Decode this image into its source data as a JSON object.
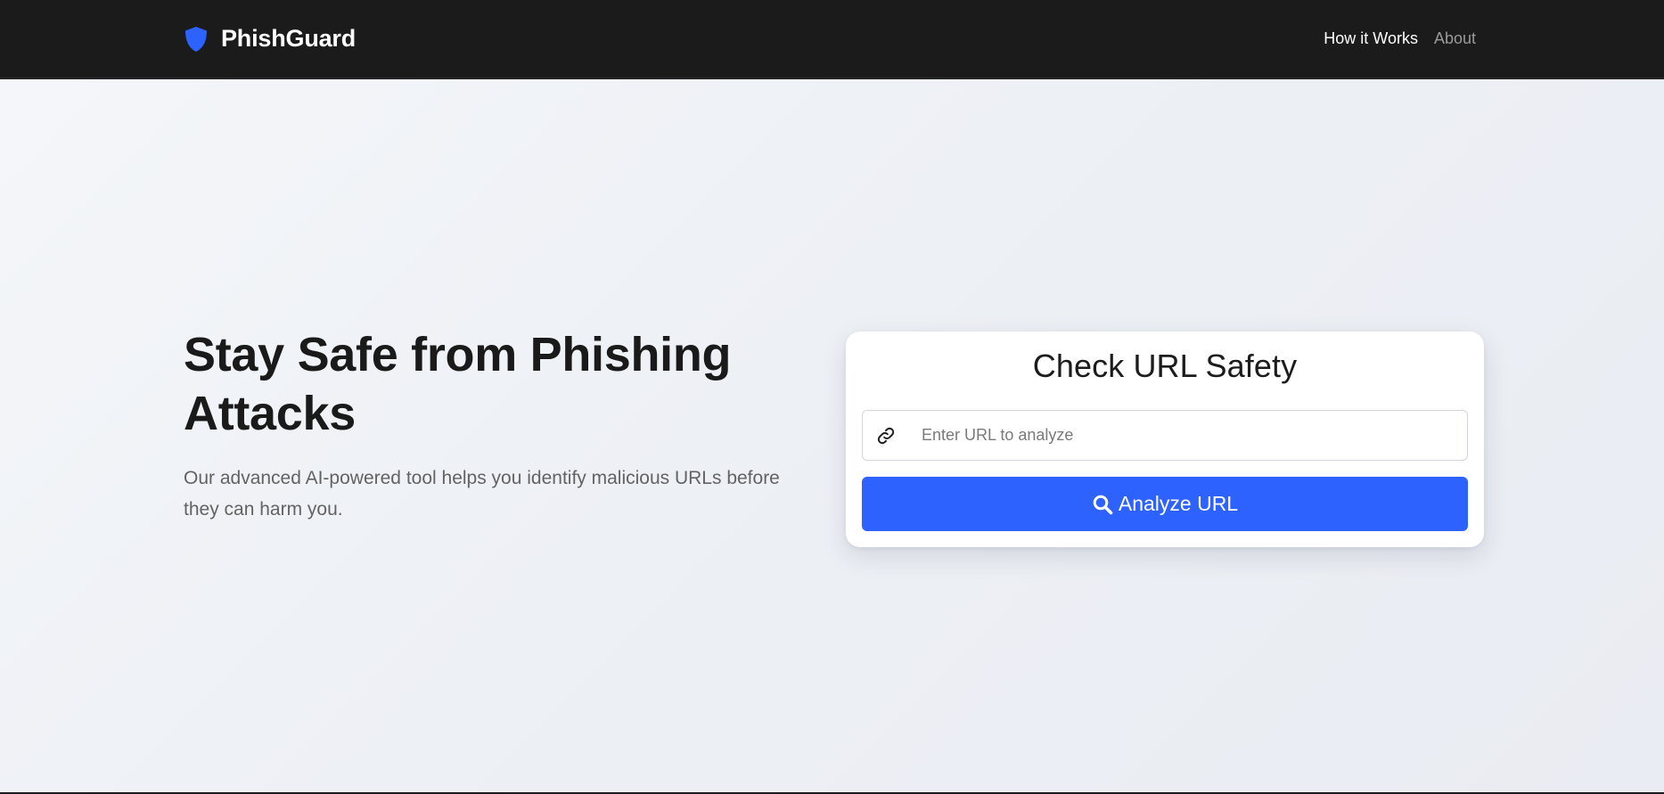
{
  "navbar": {
    "brand": "PhishGuard",
    "brand_icon": "shield-icon",
    "brand_color": "#2d62fe",
    "links": [
      {
        "label": "How it Works",
        "active": true
      },
      {
        "label": "About",
        "active": false
      }
    ]
  },
  "hero": {
    "title": "Stay Safe from Phishing Attacks",
    "subtitle": "Our advanced AI-powered tool helps you identify malicious URLs before they can harm you."
  },
  "checker": {
    "title": "Check URL Safety",
    "input_icon": "link-icon",
    "input_placeholder": "Enter URL to analyze",
    "input_value": "",
    "button_icon": "search-icon",
    "button_label": "Analyze URL",
    "button_color": "#2d62fe"
  }
}
